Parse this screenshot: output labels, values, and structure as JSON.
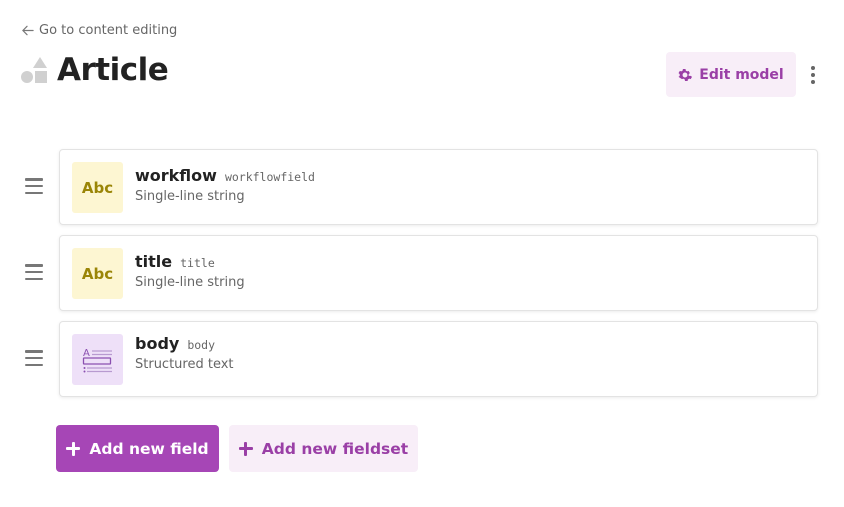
{
  "nav": {
    "back_label": "Go to content editing"
  },
  "header": {
    "title": "Article",
    "edit_model_label": "Edit model"
  },
  "fields": [
    {
      "label": "workflow",
      "api_key": "workflowfield",
      "type": "Single-line string",
      "icon": "abc-icon",
      "icon_text": "Abc"
    },
    {
      "label": "title",
      "api_key": "title",
      "type": "Single-line string",
      "icon": "abc-icon",
      "icon_text": "Abc"
    },
    {
      "label": "body",
      "api_key": "body",
      "type": "Structured text",
      "icon": "structured-text-icon"
    }
  ],
  "actions": {
    "add_field_label": "Add new field",
    "add_fieldset_label": "Add new fieldset"
  },
  "colors": {
    "accent": "#a646b6",
    "accent_light": "#f8eef8",
    "string_badge_bg": "#fdf6d2",
    "string_badge_fg": "#9a8507",
    "structured_badge_bg": "#eee0f8"
  }
}
